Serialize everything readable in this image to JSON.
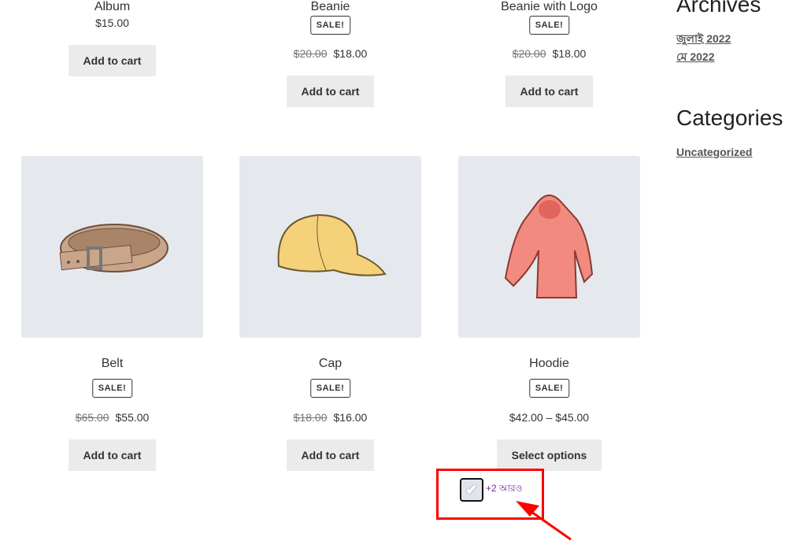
{
  "top_row": [
    {
      "name": "Album",
      "price": "$15.00",
      "button": "Add to cart"
    },
    {
      "name": "Beanie",
      "badge": "SALE!",
      "old_price": "$20.00",
      "price": "$18.00",
      "button": "Add to cart"
    },
    {
      "name": "Beanie with Logo",
      "badge": "SALE!",
      "old_price": "$20.00",
      "price": "$18.00",
      "button": "Add to cart"
    }
  ],
  "bottom_row": [
    {
      "name": "Belt",
      "badge": "SALE!",
      "old_price": "$65.00",
      "price": "$55.00",
      "button": "Add to cart",
      "image": "belt"
    },
    {
      "name": "Cap",
      "badge": "SALE!",
      "old_price": "$18.00",
      "price": "$16.00",
      "button": "Add to cart",
      "image": "cap"
    },
    {
      "name": "Hoodie",
      "badge": "SALE!",
      "price": "$42.00 – $45.00",
      "button": "Select options",
      "image": "hoodie"
    }
  ],
  "more_badge": {
    "text": "+2 আরও",
    "icon": "check-icon",
    "color": "#6b2fa0"
  },
  "sidebar": {
    "archives_title": "Archives",
    "archives": [
      "জুলাই 2022",
      "মে 2022"
    ],
    "categories_title": "Categories",
    "categories": [
      "Uncategorized"
    ]
  },
  "annotation_color": "#ff0000"
}
